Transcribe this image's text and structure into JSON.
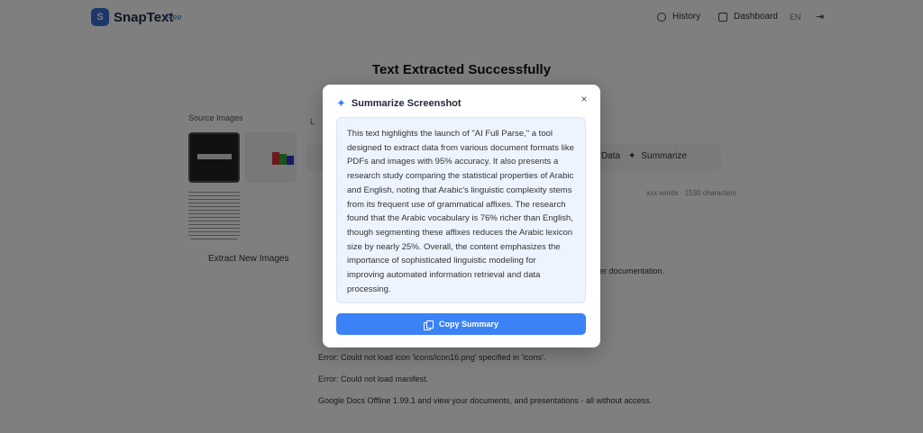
{
  "header": {
    "logo_letter": "S",
    "brand": "SnapText",
    "badge": "Free",
    "nav_history": "History",
    "nav_dashboard": "Dashboard",
    "lang": "EN"
  },
  "main": {
    "page_title": "Text Extracted Successfully",
    "source_images_label": "Source Images",
    "extract_new_label": "Extract New Images",
    "tab_data": "Data",
    "tab_summarize": "Summarize",
    "stats": "xxx words · 1530 characters",
    "bg_lines": [
      "oper documentation.",
      "Error: Could not load icon 'icons/icon16.png' specified in 'icons'.",
      "Error: Could not load manifest.",
      "Google Docs Offline 1.99.1 and view your documents, and presentations - all without access."
    ]
  },
  "modal": {
    "title": "Summarize Screenshot",
    "summary": "This text highlights the launch of \"AI Full Parse,\" a tool designed to extract data from various document formats like PDFs and images with 95% accuracy. It also presents a research study comparing the statistical properties of Arabic and English, noting that Arabic's linguistic complexity stems from its frequent use of grammatical affixes. The research found that the Arabic vocabulary is 76% richer than English, though segmenting these affixes reduces the Arabic lexicon size by nearly 25%. Overall, the content emphasizes the importance of sophisticated linguistic modeling for improving automated information retrieval and data processing.",
    "copy_label": "Copy Summary",
    "close_symbol": "×",
    "sparkle_symbol": "✦"
  },
  "colors": {
    "accent": "#3b82f6",
    "overlay": "rgba(0,0,0,0.5)",
    "summary_bg": "#eef4ff"
  }
}
